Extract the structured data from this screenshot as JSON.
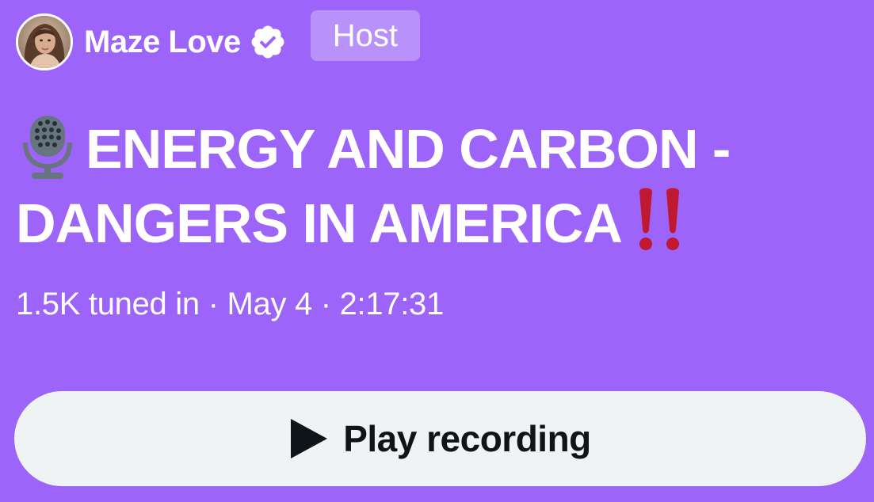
{
  "host": {
    "avatar_icon": "avatar",
    "name": "Maze Love",
    "verified_icon": "verified-badge-icon",
    "role_badge": "Host"
  },
  "space": {
    "title_icon": "microphone-icon",
    "title": "ENERGY AND CARBON - DANGERS IN AMERICA",
    "title_suffix_icon": "double-exclamation-icon",
    "meta": "1.5K tuned in · May 4 · 2:17:31"
  },
  "actions": {
    "play_icon": "play-icon",
    "play_label": "Play recording"
  },
  "colors": {
    "background": "#9c64f9",
    "badge_background": "#b891fb",
    "button_background": "#eff3f4",
    "button_text": "#0f1419",
    "exclamation": "#be1931"
  }
}
